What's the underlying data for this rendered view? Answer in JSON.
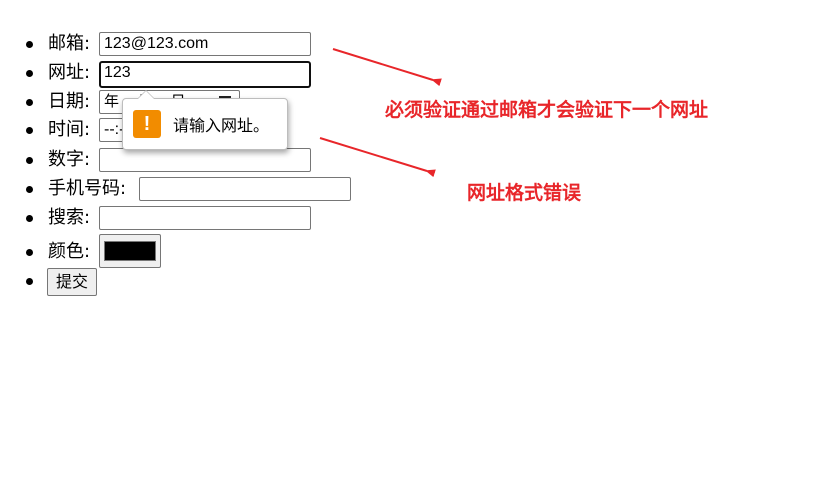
{
  "form": {
    "email": {
      "label": "邮箱:",
      "value": "123@123.com"
    },
    "url": {
      "label": "网址:",
      "value": "123"
    },
    "date": {
      "label": "日期:",
      "value": "年 -- 月 -- 日"
    },
    "time": {
      "label": "时间:",
      "value": "--:--"
    },
    "number": {
      "label": "数字:",
      "value": ""
    },
    "phone": {
      "label": "手机号码:",
      "value": ""
    },
    "search": {
      "label": "搜索:",
      "value": ""
    },
    "color": {
      "label": "颜色:",
      "value": "#000000"
    },
    "submit": {
      "label": "提交"
    }
  },
  "validation_tooltip": {
    "icon": "exclamation-icon",
    "message": "请输入网址。",
    "icon_color": "#f28c00"
  },
  "annotations": {
    "note_email_first": "必须验证通过邮箱才会验证下一个网址",
    "note_url_format": "网址格式错误",
    "color": "#e8262a"
  }
}
